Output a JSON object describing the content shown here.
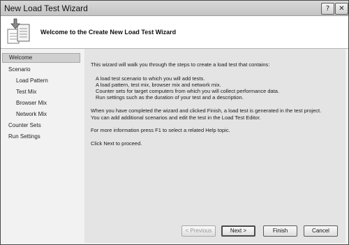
{
  "window": {
    "title": "New Load Test Wizard",
    "help_glyph": "?",
    "close_glyph": "✕"
  },
  "header": {
    "title": "Welcome to the Create New Load Test Wizard",
    "icon": "wizard-document-icon"
  },
  "sidebar": {
    "items": [
      {
        "label": "Welcome",
        "level": 1,
        "active": true
      },
      {
        "label": "Scenario",
        "level": 1
      },
      {
        "label": "Load Pattern",
        "level": 2
      },
      {
        "label": "Test Mix",
        "level": 2
      },
      {
        "label": "Browser Mix",
        "level": 2
      },
      {
        "label": "Network Mix",
        "level": 2
      },
      {
        "label": "Counter Sets",
        "level": 1
      },
      {
        "label": "Run Settings",
        "level": 1
      }
    ]
  },
  "content": {
    "intro": "This wizard will walk you through the steps to create a load test that contains:",
    "bullets": [
      "A load test scenario to which you will add tests.",
      "A load pattern, test mix, browser mix and network mix.",
      "Counter sets for target computers from which you will collect performance data.",
      "Run settings such as the duration of your test and a description."
    ],
    "finish_note_1": "When you have completed the wizard and clicked Finish, a load test is generated in the test project.",
    "finish_note_2": "You can add additional scenarios and edit the test in the Load Test Editor.",
    "help_note": "For more information press F1 to select a related Help topic.",
    "proceed_note": "Click Next to proceed."
  },
  "buttons": {
    "previous": "< Previous",
    "next": "Next >",
    "finish": "Finish",
    "cancel": "Cancel"
  }
}
